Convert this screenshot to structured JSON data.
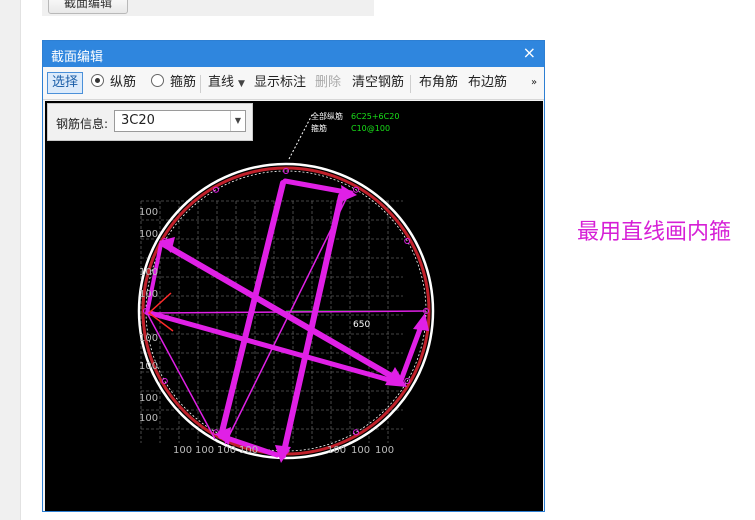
{
  "background_ui": {
    "top_button_label": "截面编辑"
  },
  "dialog": {
    "title": "截面编辑",
    "close_glyph": "×"
  },
  "toolbar": {
    "select": "选择",
    "longitudinal": "纵筋",
    "stirrup": "箍筋",
    "line_mode": "直线",
    "show_dims": "显示标注",
    "delete": "删除",
    "clear_rebar": "清空钢筋",
    "corner_rebar": "布角筋",
    "edge_rebar": "布边筋",
    "more": "»"
  },
  "rebar_info": {
    "label": "钢筋信息:",
    "value": "3C20"
  },
  "drawing": {
    "legend_long_label": "全部纵筋",
    "legend_long_value": "6C25+6C20",
    "legend_stirrup_label": "箍筋",
    "legend_stirrup_value": "C10@100",
    "radius_dim": "650",
    "grid_spacing": "100",
    "colors": {
      "rebar": "#e020e6",
      "outline": "#ffffff",
      "cover": "#c0202a",
      "dim": "#22c22a",
      "legend_value": "#19e019",
      "grid": "#5a5a5a"
    }
  },
  "annotation": {
    "text": "最用直线画内箍",
    "color": "#d61fd6"
  }
}
